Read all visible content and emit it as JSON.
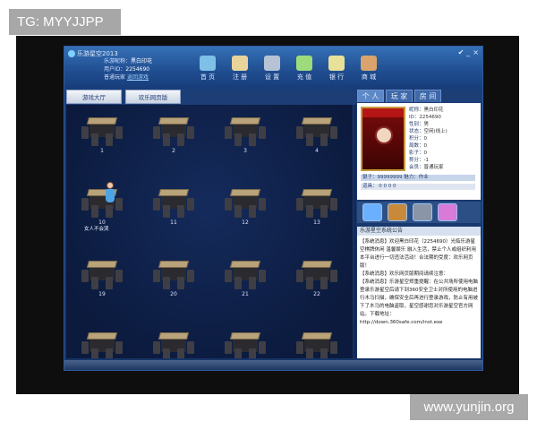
{
  "watermarks": {
    "top": "TG: MYYJJPP",
    "bottom": "www.yunjin.org"
  },
  "window": {
    "title": "乐游星空2013",
    "controls": [
      "✔",
      "_",
      "×"
    ]
  },
  "user": {
    "lines": [
      {
        "label": "乐游昵称：",
        "value": "黑白印花"
      },
      {
        "label": "用户ID：",
        "value": "2254690"
      },
      {
        "label": "普通玩家",
        "value": "返回游戏"
      }
    ]
  },
  "toolbar": [
    {
      "icon": "monitor-icon",
      "label": "首 页",
      "color": "#7ec0e8"
    },
    {
      "icon": "notepad-icon",
      "label": "注 册",
      "color": "#e8d49a"
    },
    {
      "icon": "gear-icon",
      "label": "设 置",
      "color": "#b7c3d4"
    },
    {
      "icon": "gamepad-icon",
      "label": "充 值",
      "color": "#9edb7c"
    },
    {
      "icon": "folder-icon",
      "label": "银 行",
      "color": "#e8e19a"
    },
    {
      "icon": "shop-icon",
      "label": "商 城",
      "color": "#d9a36b"
    }
  ],
  "left_tabs": [
    "游戏大厅",
    "欢乐网页版"
  ],
  "right_tabs": [
    "个 人",
    "玩 家",
    "房 间"
  ],
  "tables": [
    {
      "num": "1"
    },
    {
      "num": "2"
    },
    {
      "num": "3"
    },
    {
      "num": "4"
    },
    {
      "num": "10",
      "player": "女人不会哭"
    },
    {
      "num": "11"
    },
    {
      "num": "12"
    },
    {
      "num": "13"
    },
    {
      "num": "19"
    },
    {
      "num": "20"
    },
    {
      "num": "21"
    },
    {
      "num": "22"
    },
    {
      "num": ""
    },
    {
      "num": ""
    },
    {
      "num": ""
    },
    {
      "num": ""
    }
  ],
  "profile": {
    "stats": [
      {
        "label": "昵称：",
        "value": "黑白印花"
      },
      {
        "label": "ID：",
        "value": "2254690"
      },
      {
        "label": "性别：",
        "value": "男"
      },
      {
        "label": "状态：",
        "value": "空闲(线上)"
      },
      {
        "label": "积分：",
        "value": "0"
      },
      {
        "label": "局数：",
        "value": "0"
      },
      {
        "label": "影子：",
        "value": "0"
      },
      {
        "label": "称分：",
        "value": "-1"
      },
      {
        "label": "会员：",
        "value": "普通玩家"
      }
    ],
    "bar1": "银子：99999999    魅力：作业",
    "bar2": "道具： 0   0   0   0"
  },
  "gifts": [
    {
      "icon": "diamond-gift-icon",
      "color": "#6ab0ff"
    },
    {
      "icon": "ring-gift-icon",
      "color": "#c88a3a"
    },
    {
      "icon": "car-gift-icon",
      "color": "#8a95a8"
    },
    {
      "icon": "card-gift-icon",
      "color": "#d77ad8"
    }
  ],
  "notice": {
    "title": "乐游星空系统公告",
    "body": [
      "【系统消息】欢迎黑白印花（2254690）光临乐游星空棋牌休闲 温馨娱乐 融入生活，禁止个人或组织利用本平台进行一切违法活动！合法期的受度：欢乐网页版！",
      "【系统消息】欢乐网页版期间请续注意：",
      "【系统消息】乐游星空郑重提醒：在公共场所使用电脑登录乐游星空后请下到360安全卫士对所使用的电脑进行木马扫描，确保安全后再进行登录游戏，防止有用被下了木马的电脑盗取，星空感谢您对乐游星空官方网站。下载地址：",
      "http://down.360safe.com/inst.exe"
    ]
  }
}
